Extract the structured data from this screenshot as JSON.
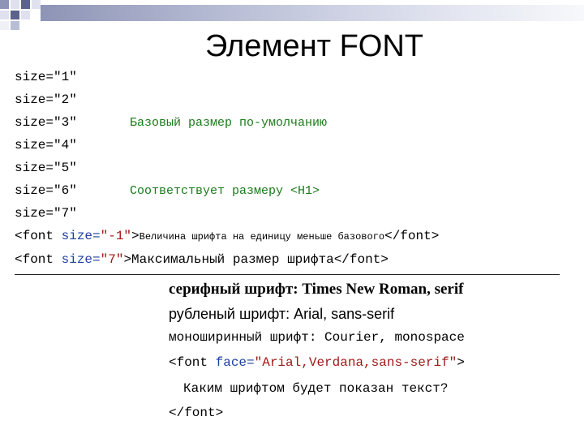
{
  "title": "Элемент FONT",
  "sizes": [
    {
      "label": "size=\"1\""
    },
    {
      "label": "size=\"2\""
    },
    {
      "label": "size=\"3\"",
      "note": "Базовый размер по-умолчанию"
    },
    {
      "label": "size=\"4\""
    },
    {
      "label": "size=\"5\""
    },
    {
      "label": "size=\"6\"",
      "note": "Соответствует размеру <H1>"
    },
    {
      "label": "size=\"7\""
    }
  ],
  "code1": {
    "open": "<font ",
    "attr": "size=",
    "value": "\"-1\"",
    "close": ">",
    "text": "Величина шрифта на единицу меньше базового",
    "end": "</font>"
  },
  "code2": {
    "open": "<font ",
    "attr": "size=",
    "value": "\"7\"",
    "close": ">",
    "text": "Максимальный размер шрифта",
    "end": "</font>"
  },
  "examples": {
    "serif": "серифный шрифт: Times New Roman, serif",
    "sans": "рубленый шрифт: Arial, sans-serif",
    "mono": "моноширинный шрифт: Courier, monospace",
    "face_open": "<font ",
    "face_attr": "face=",
    "face_value": "\"Arial,Verdana,sans-serif\"",
    "face_close": ">",
    "question": "Каким шрифтом будет показан текст?",
    "face_end": "</font>"
  },
  "colors": {
    "accent_green": "#1a7a1a",
    "attr_blue": "#1f3fa0",
    "value_red": "#a01818",
    "bar": "#8d94b5"
  }
}
